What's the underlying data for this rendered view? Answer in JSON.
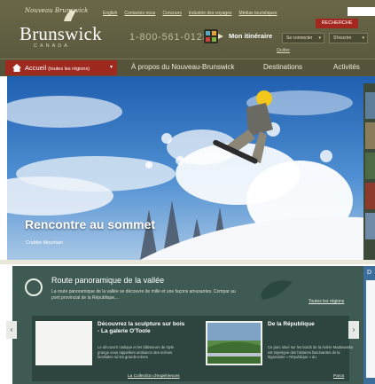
{
  "header": {
    "logo": {
      "script": "Nouveau Brunswick",
      "name": "Brunswick",
      "tagline": "CANADA"
    },
    "top_links": [
      "English",
      "Contactez-nous",
      "Concours",
      "Industrie des voyages",
      "Médias touristiques"
    ],
    "search_label": "RECHERCHE",
    "phone": "1-800-561-0123",
    "itinerary_label": "Mon itinéraire",
    "login_label": "Se connecter",
    "register_label": "S'inscrire",
    "quit_label": "Quitter"
  },
  "nav": {
    "home_label": "Accueil",
    "home_sub": "(toutes les régions)",
    "items": [
      "À propos du Nouveau-Brunswick",
      "Destinations",
      "Activités"
    ]
  },
  "hero": {
    "title": "Rencontre au sommet",
    "subtitle": "Crabbe Mountain"
  },
  "panel": {
    "title": "Route panoramique de la vallée",
    "description": "La route panoramique de la vallée se découvre de mille et une façons amusantes. Compar au pont provincial de la République,...",
    "all_regions_link": "Toutes les régions",
    "right_letter": "D",
    "cards": [
      {
        "title": "Découvrez la sculpture sur bois - La galerie O'Toole",
        "text": "Le découvrir rustique et les bâtisseurs de style grange vous rappellent ambiance des scènes familiales où les grands-mères",
        "link": "La Collection d'expériences"
      },
      {
        "title": "De la République",
        "text": "Ce parc situé sur les bords de la rivière Madawaska est imprégné des histoires fascinantes de la légendaire « République » du",
        "link": "Parcs"
      }
    ]
  },
  "colors": {
    "header_bg": "#5b5a3f",
    "nav_home_bg": "#9e2a1f",
    "panel_bg": "#3f5a52",
    "search_btn": "#a3271f"
  }
}
